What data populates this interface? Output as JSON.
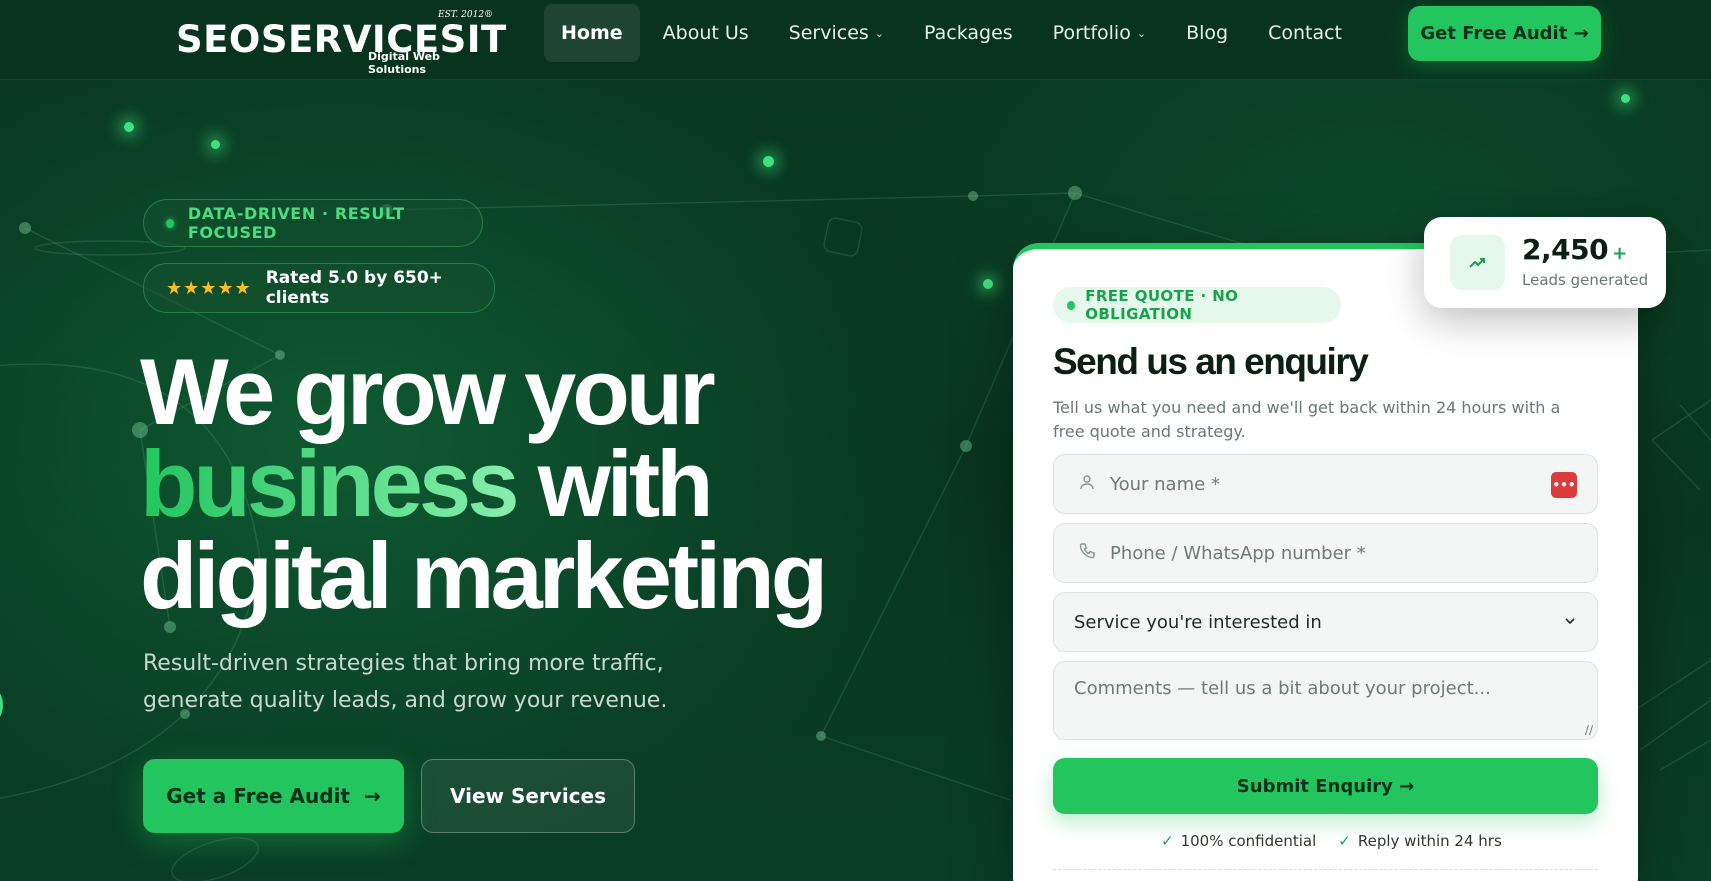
{
  "nav": {
    "logo_main": "SEOSERVICESIT",
    "logo_est": "EST. 2012®",
    "logo_sub": "Digital Web Solutions",
    "links": [
      {
        "label": "Home",
        "active": true
      },
      {
        "label": "About Us"
      },
      {
        "label": "Services",
        "dropdown": true
      },
      {
        "label": "Packages"
      },
      {
        "label": "Portfolio",
        "dropdown": true
      },
      {
        "label": "Blog"
      },
      {
        "label": "Contact"
      }
    ],
    "cta_label": "Get Free Audit →"
  },
  "hero": {
    "tag_label": "DATA-DRIVEN · RESULT FOCUSED",
    "rating_stars": "★★★★★",
    "rating_label": "Rated 5.0 by 650+ clients",
    "headline_1": "We grow your",
    "headline_green": "business",
    "headline_2": "with",
    "headline_3": "digital marketing",
    "lead": "Result-driven strategies that bring more traffic, generate quality leads, and grow your revenue.",
    "primary_button": "Get a Free Audit",
    "primary_arrow": "→",
    "secondary_button": "View Services"
  },
  "form": {
    "badge": "FREE QUOTE · NO OBLIGATION",
    "title": "Send us an enquiry",
    "description": "Tell us what you need and we'll get back within 24 hours with a free quote and strategy.",
    "name_placeholder": "Your name *",
    "phone_placeholder": "Phone / WhatsApp number *",
    "service_selected": "Service you're interested in",
    "comments_placeholder": "Comments — tell us a bit about your project...",
    "submit_label": "Submit Enquiry →",
    "trust": [
      "100% confidential",
      "Reply within 24 hrs"
    ]
  },
  "stat": {
    "value": "2,450",
    "suffix": "+",
    "label": "Leads generated"
  },
  "colors": {
    "accent": "#22c55e",
    "background": "#0a3d23",
    "card": "#ffffff"
  },
  "icons": [
    "user-icon",
    "phone-icon",
    "chevron-down-icon",
    "trending-up-icon",
    "check-icon",
    "star-icon",
    "arrow-right-icon"
  ]
}
